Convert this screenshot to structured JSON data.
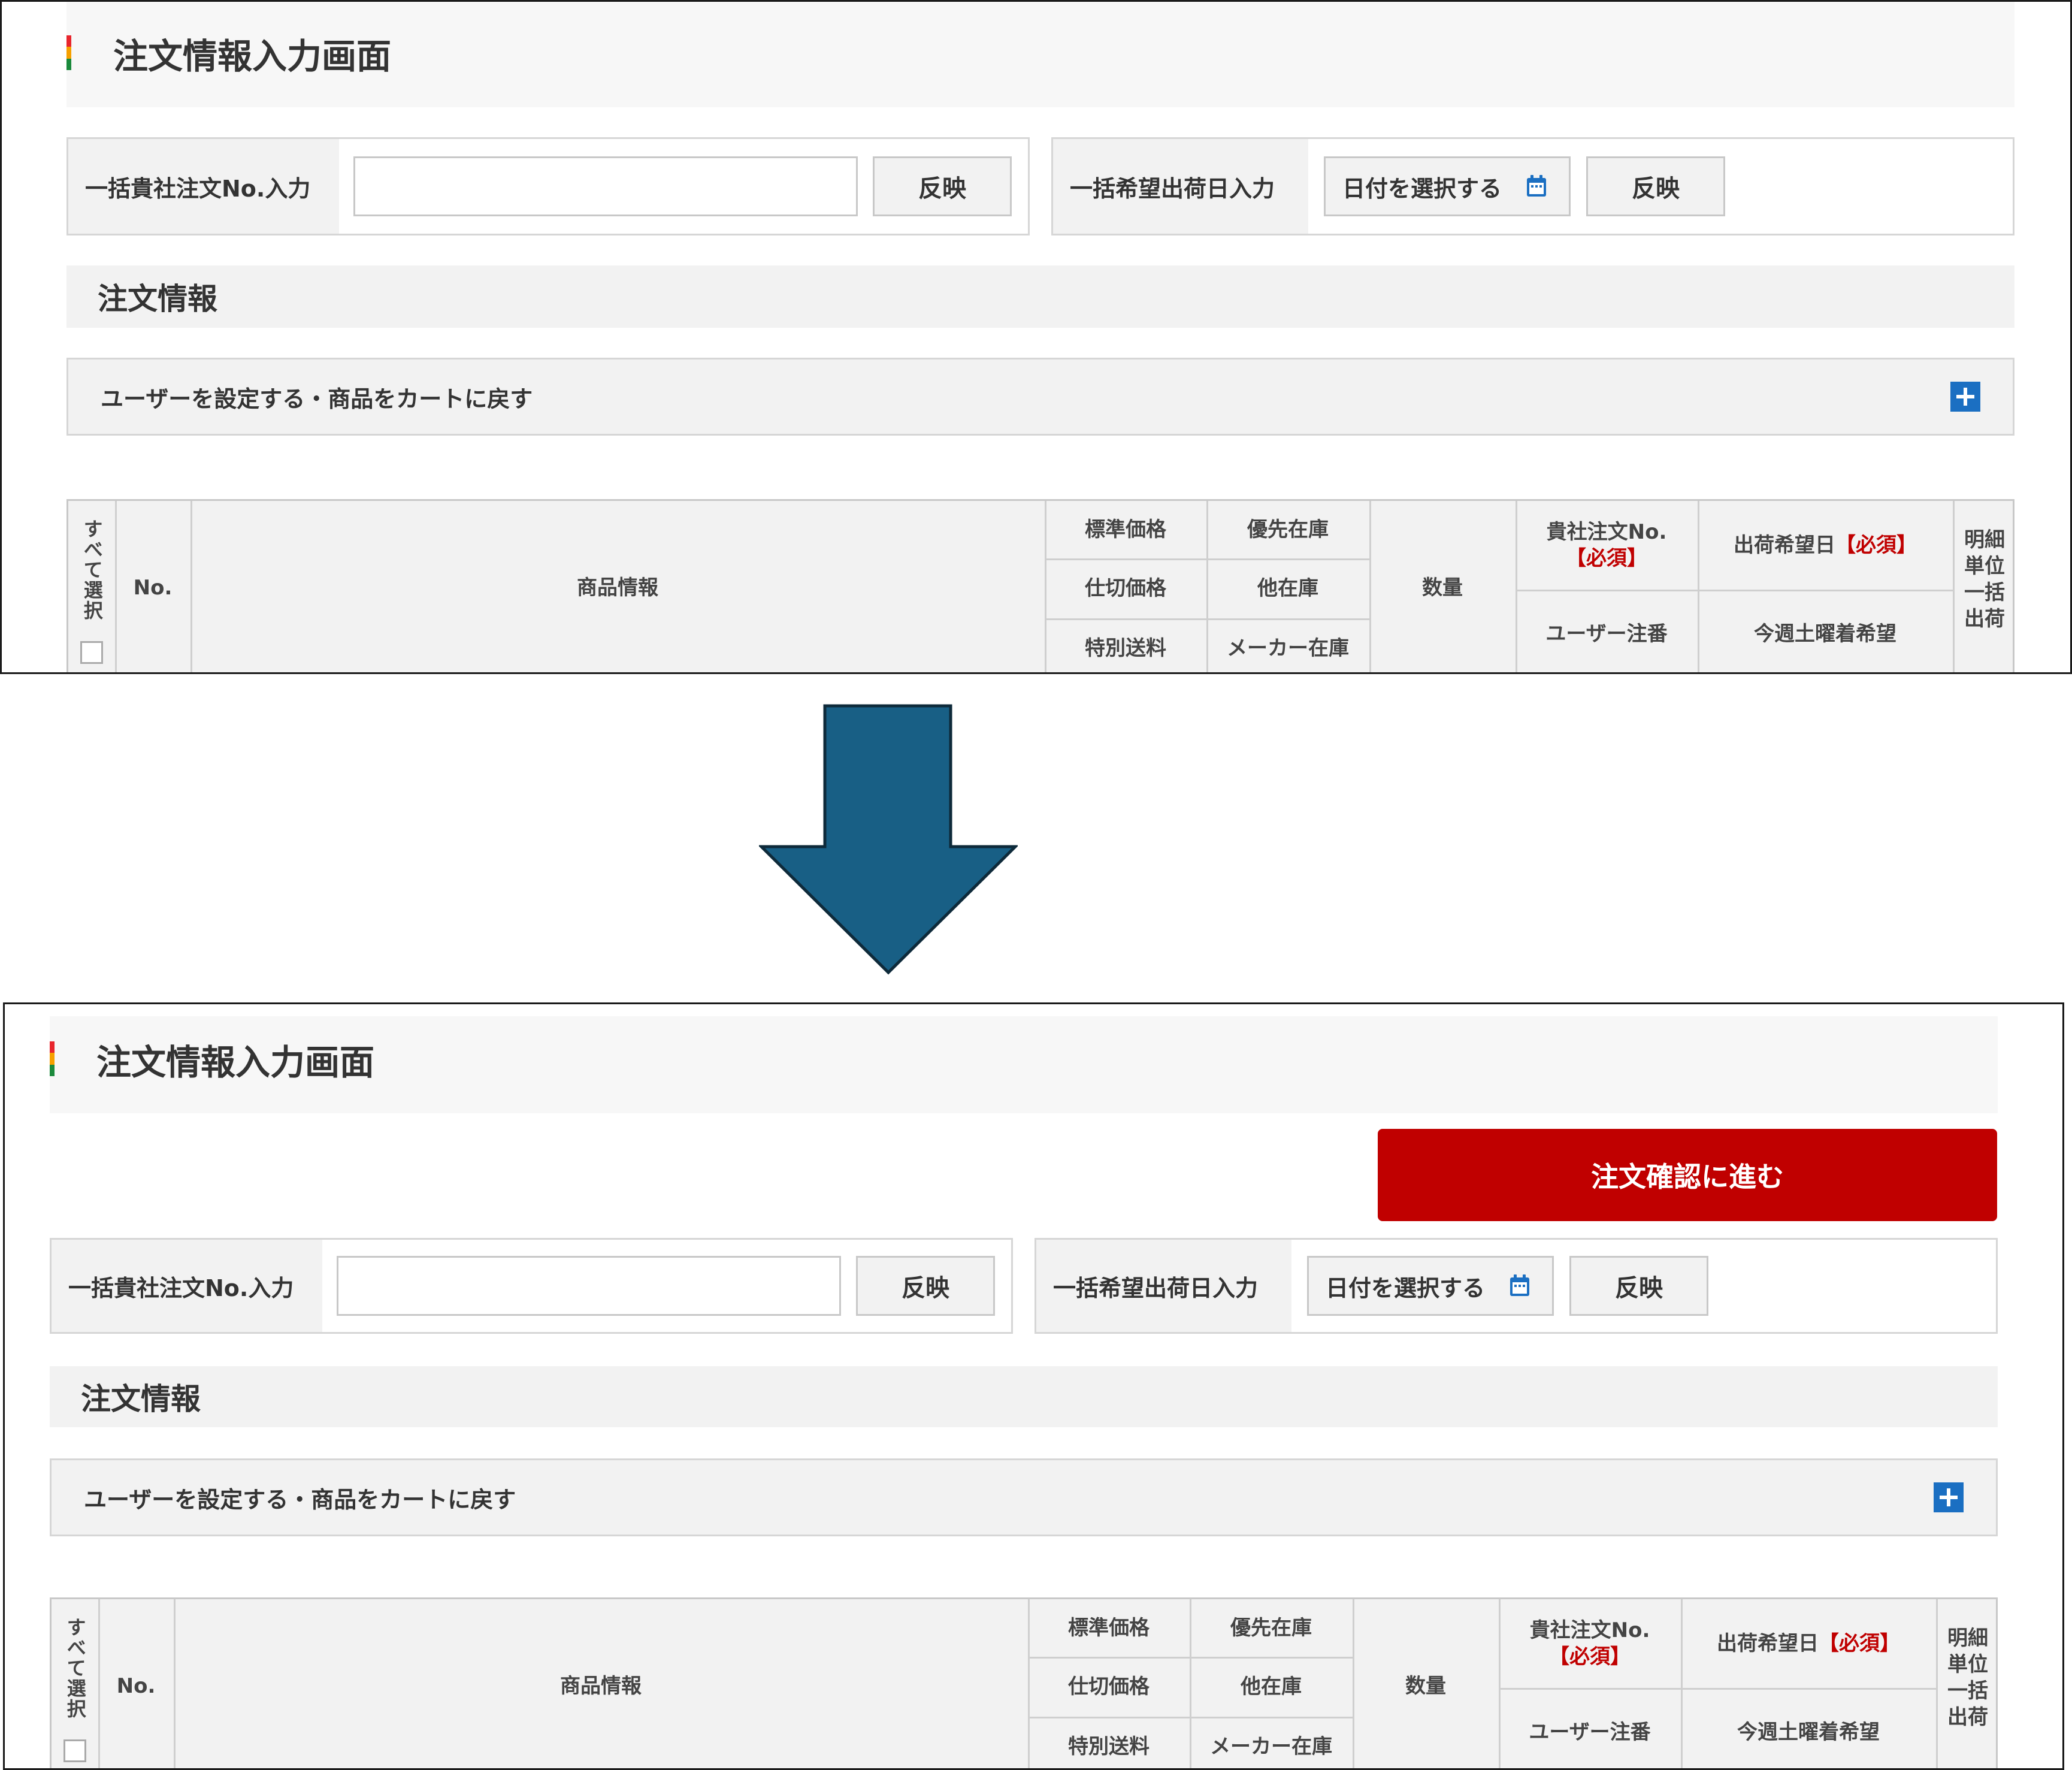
{
  "colors": {
    "accent_stripe": [
      "#e8262d",
      "#f6a000",
      "#1b8a3c"
    ],
    "primary_button": "#c00000",
    "plus_icon": "#1b6fc2",
    "arrow_fill": "#185f85",
    "required_text": "#c00000"
  },
  "page": {
    "title": "注文情報入力画面"
  },
  "actions": {
    "confirm_label": "注文確認に進む"
  },
  "bulk_order_no": {
    "label": "一括貴社注文No.入力",
    "value": "",
    "apply_label": "反映"
  },
  "bulk_ship_date": {
    "label": "一括希望出荷日入力",
    "date_label": "日付を選択する",
    "apply_label": "反映"
  },
  "section": {
    "title": "注文情報"
  },
  "accordion": {
    "label": "ユーザーを設定する・商品をカートに戻す"
  },
  "table": {
    "select_all": "すべて選択",
    "no": "No.",
    "product_info": "商品情報",
    "standard_price": "標準価格",
    "wholesale_price": "仕切価格",
    "special_shipping": "特別送料",
    "priority_stock": "優先在庫",
    "other_stock": "他在庫",
    "maker_stock": "メーカー在庫",
    "quantity": "数量",
    "order_no": "貴社注文No.",
    "required": "【必須】",
    "ship_date": "出荷希望日",
    "user_order_no": "ユーザー注番",
    "saturday_request": "今週土曜着希望",
    "detail_unit": [
      "明細",
      "単位",
      "一括",
      "出荷"
    ]
  }
}
